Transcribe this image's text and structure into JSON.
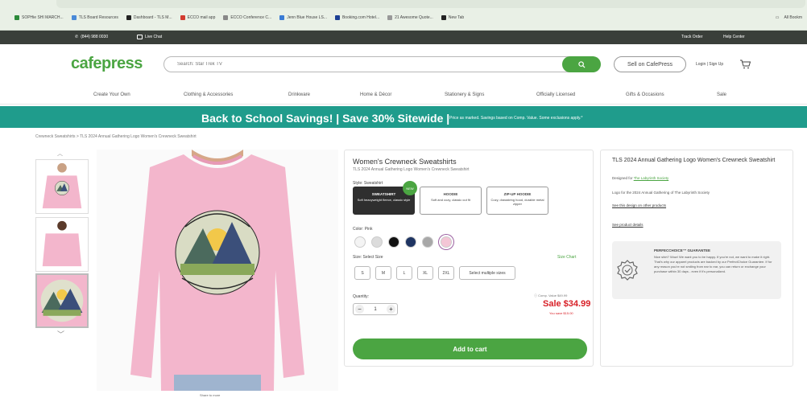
{
  "browser": {
    "bookmarks": [
      {
        "label": "SOPHie SHI MARCH..."
      },
      {
        "label": "TLS Board Resources"
      },
      {
        "label": "Dashboard - TLS M..."
      },
      {
        "label": "ECCO mail app"
      },
      {
        "label": "ECCO Conference C..."
      },
      {
        "label": "Jenn Blue House LS..."
      },
      {
        "label": "Booking.com Hotel..."
      },
      {
        "label": "21 Awesome Quote..."
      },
      {
        "label": "New Tab"
      }
    ],
    "bookmarks_right": "All Bookm"
  },
  "topbar": {
    "phone": "(844) 988 0030",
    "chat": "Live Chat",
    "track_order": "Track Order",
    "help_center": "Help Center"
  },
  "header": {
    "logo": "cafepress",
    "search_placeholder": "Search: Star Trek TV",
    "sell_label": "Sell on CafePress",
    "login_label": "Login | Sign Up"
  },
  "categories": [
    "Create Your Own",
    "Clothing & Accessories",
    "Drinkware",
    "Home & Décor",
    "Stationery & Signs",
    "Officially Licensed",
    "Gifts & Occasions",
    "Sale"
  ],
  "banner": {
    "main": "Back to School Savings! | Save 30% Sitewide |",
    "sub": "Price as marked. Savings based on Comp. Value. Some exclusions apply.*"
  },
  "breadcrumb": "Crewneck Sweatshirts  >  TLS 2024 Annual Gathering Logo Women's Crewneck Sweatshirt",
  "product": {
    "title": "Women's Crewneck Sweatshirts",
    "subtitle": "TLS 2024 Annual Gathering Logo Women's Crewneck Sweatshirt",
    "style_label": "Style: Sweatshirt",
    "styles": [
      {
        "name": "SWEATSHIRT",
        "desc": "Soft heavyweight fleece, classic style"
      },
      {
        "name": "HOODIE",
        "desc": "Soft and cozy, classic cut fit"
      },
      {
        "name": "ZIP-UP HOODIE",
        "desc": "Cozy, drawstring hood, durable metal zipper"
      }
    ],
    "new_badge": "NEW",
    "color_label": "Color: Pink",
    "swatches": [
      "#f4f4f4",
      "#dcdcdc",
      "#111111",
      "#1e3462",
      "#a8a8a8",
      "#f4c6d6"
    ],
    "size_label": "Size: Select Size",
    "size_chart": "Size Chart",
    "sizes": [
      "S",
      "M",
      "L",
      "XL",
      "2XL"
    ],
    "select_multiple": "Select multiple sizes",
    "quantity_label": "Quantity:",
    "quantity": "1",
    "compare_value": "Comp. Value $49.99",
    "sale_price": "Sale $34.99",
    "you_save": "You save $15.00",
    "add_to_cart": "Add to cart",
    "share_label": "Share to more"
  },
  "info": {
    "title": "TLS 2024 Annual Gathering Logo Women's Crewneck Sweatshirt",
    "designed_for": "Designed for ",
    "designer": "The Labyrinth Society",
    "description": "Logo for the 2024 Annual Gathering of The Labyrinth Society",
    "see_designs": "See this design on other products",
    "see_details": "See product details",
    "guarantee_title": "PERFECCHOICE™ GUARANTEE",
    "guarantee_body": "Nice shirt? Wow! We want you to be happy. If you're not, we want to make it right. That's why our apparel products are backed by our PerfectChoice Guarantee. If for any reason you're not smiling from ear to ear, you can return or exchange your purchase within 30 days - even if it's personalized."
  },
  "colors": {
    "brand_green": "#4ba542",
    "banner_teal": "#1f9c8c",
    "sale_red": "#d82027"
  }
}
